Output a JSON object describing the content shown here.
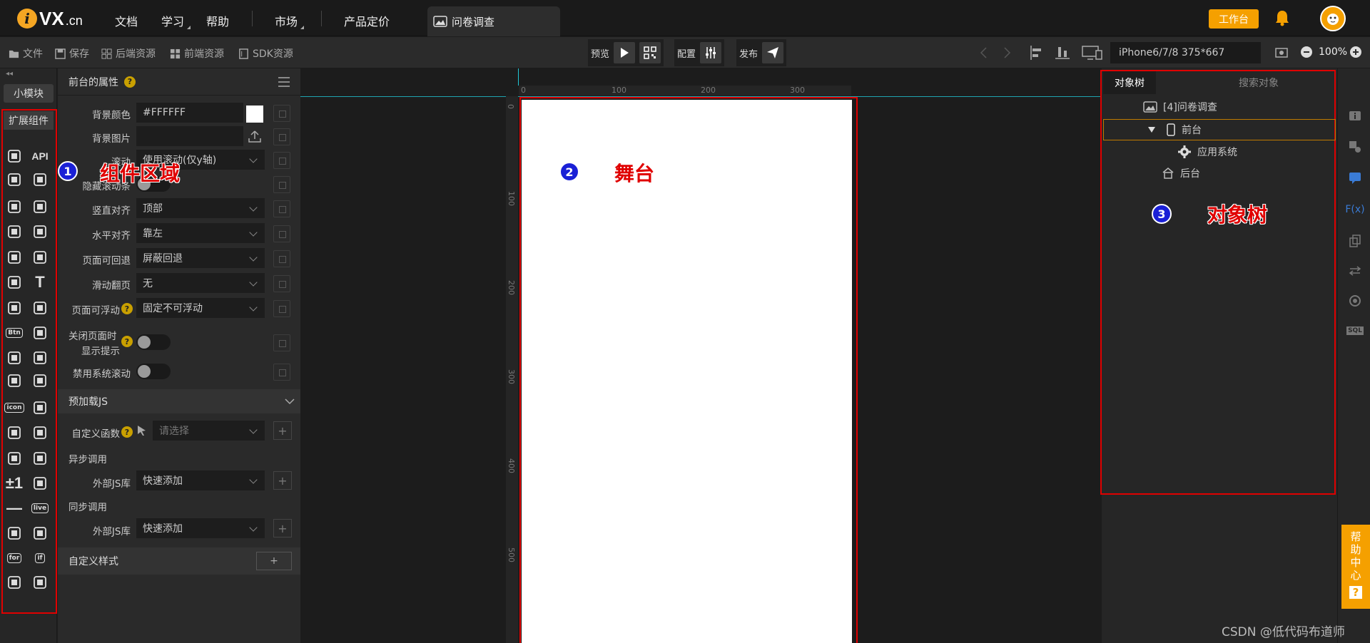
{
  "topnav": {
    "logo_letter": "i",
    "logo_brand": "VX",
    "logo_domain": ".cn",
    "items": [
      {
        "label": "文档"
      },
      {
        "label": "学习"
      },
      {
        "label": "帮助"
      },
      {
        "label": "市场"
      },
      {
        "label": "产品定价"
      }
    ],
    "doc_tab": "问卷调查",
    "workspace": "工作台"
  },
  "toolbar": {
    "file": "文件",
    "save": "保存",
    "backend_res": "后端资源",
    "frontend_res": "前端资源",
    "sdk_res": "SDK资源",
    "preview": "预览",
    "config": "配置",
    "publish": "发布",
    "device": "iPhone6/7/8 375*667",
    "zoom": "100%"
  },
  "components": {
    "small_module": "小模块",
    "extend": "扩展组件",
    "items": [
      "cube",
      "API",
      "pinwheel",
      "cloud-mqtt",
      "gear",
      "download",
      "upload",
      "list",
      "device",
      "image",
      "image-2",
      "T",
      "translate",
      "edit",
      "Btn",
      "music",
      "video",
      "text-box",
      "text-box-2",
      "ie",
      "icon",
      "word",
      "excel",
      "ppt",
      "brush",
      "leaf",
      "±1",
      "qr",
      "—",
      "live",
      "player",
      "mixer",
      "for",
      "if",
      "chart",
      "expand"
    ]
  },
  "props": {
    "title": "前台的属性",
    "rows": [
      {
        "label": "背景颜色",
        "value": "#FFFFFF"
      },
      {
        "label": "背景图片",
        "value": ""
      },
      {
        "label": "滚动",
        "value": "使用滚动(仅y轴)"
      },
      {
        "label": "隐藏滚动条",
        "value": ""
      },
      {
        "label": "竖直对齐",
        "value": "顶部"
      },
      {
        "label": "水平对齐",
        "value": "靠左"
      },
      {
        "label": "页面可回退",
        "value": "屏蔽回退"
      },
      {
        "label": "滑动翻页",
        "value": "无"
      },
      {
        "label": "页面可浮动",
        "value": "固定不可浮动"
      },
      {
        "label": "关闭页面时",
        "label2": "显示提示",
        "value": ""
      },
      {
        "label": "禁用系统滚动",
        "value": ""
      }
    ],
    "preload_section": "预加载JS",
    "custom_func_label": "自定义函数",
    "custom_func_placeholder": "请选择",
    "async_label": "异步调用",
    "sync_label": "同步调用",
    "extjs_label": "外部JS库",
    "extjs_value": "快速添加",
    "custom_style_section": "自定义样式",
    "custom_style_add": "+"
  },
  "canvas": {
    "ruler_top": [
      "0",
      "100",
      "200",
      "300"
    ],
    "ruler_left": [
      "0",
      "100",
      "200",
      "300",
      "400",
      "500"
    ]
  },
  "annotations": {
    "n1": "1",
    "t1": "组件区域",
    "n2": "2",
    "t2": "舞台",
    "n3": "3",
    "t3": "对象树"
  },
  "tree": {
    "tab": "对象树",
    "search_placeholder": "搜索对象",
    "nodes": [
      {
        "label": "[4]问卷调查",
        "icon": "image-icon"
      },
      {
        "label": "前台",
        "icon": "phone-icon"
      },
      {
        "label": "应用系统",
        "icon": "gear-icon"
      },
      {
        "label": "后台",
        "icon": "backend-icon"
      }
    ]
  },
  "right_rail": {
    "help_center": [
      "帮",
      "助",
      "中",
      "心"
    ],
    "help_q": "?"
  },
  "watermark": "CSDN @低代码布道师",
  "colors": {
    "accent": "#f5a000",
    "annotation_red": "#e00000",
    "badge_blue": "#1a20d6",
    "guide_cyan": "#20c7d6"
  }
}
